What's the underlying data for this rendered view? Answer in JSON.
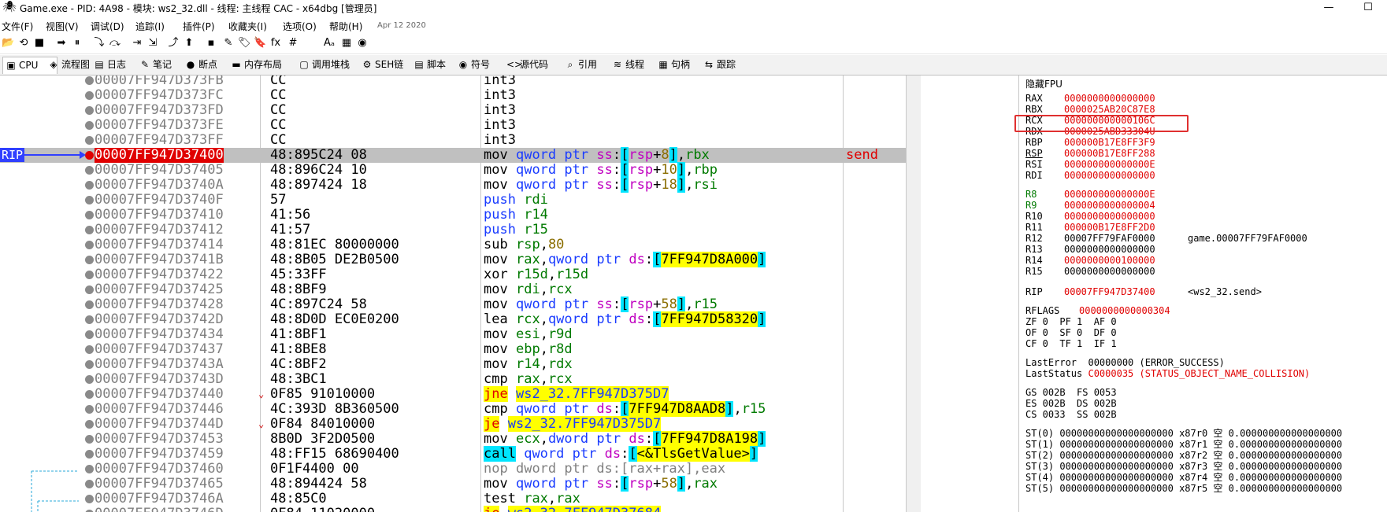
{
  "window": {
    "title": "Game.exe - PID: 4A98 - 模块: ws2_32.dll - 线程: 主线程 CAC - x64dbg [管理员]",
    "minimize": "—",
    "maximize": "☐"
  },
  "menu": {
    "items": [
      "文件(F)",
      "视图(V)",
      "调试(D)",
      "追踪(I)",
      "插件(P)",
      "收藏夹(I)",
      "选项(O)",
      "帮助(H)"
    ],
    "date": "Apr 12 2020"
  },
  "toolbar": {
    "icons": [
      "open-icon",
      "restart-icon",
      "stop-icon",
      "run-icon",
      "pause-icon",
      "step-into-icon",
      "step-over-icon",
      "trace-into-icon",
      "trace-over-icon",
      "execute-till-return-icon",
      "run-to-user-code-icon",
      "patch-icon",
      "comment-icon",
      "label-icon",
      "bookmark-icon",
      "function-icon",
      "tag-icon",
      "strings-icon",
      "calculator-icon",
      "script-icon"
    ],
    "glyphs": [
      "📂",
      "⟲",
      "■",
      "➡",
      "⏸",
      "⤵",
      "⤼",
      "⇥",
      "⇲",
      "⤴",
      "⬆",
      "▪",
      "✎",
      "🏷",
      "🔖",
      "fx",
      "#",
      "Aₐ",
      "▦",
      "◉"
    ]
  },
  "tabs": [
    {
      "label": "CPU",
      "icon": "cpu-icon",
      "glyph": "▣"
    },
    {
      "label": "流程图",
      "icon": "graph-icon",
      "glyph": "◈"
    },
    {
      "label": "日志",
      "icon": "log-icon",
      "glyph": "▤"
    },
    {
      "label": "笔记",
      "icon": "notes-icon",
      "glyph": "✎"
    },
    {
      "label": "断点",
      "icon": "breakpoint-icon",
      "glyph": "●"
    },
    {
      "label": "内存布局",
      "icon": "memory-map-icon",
      "glyph": "▬"
    },
    {
      "label": "调用堆栈",
      "icon": "call-stack-icon",
      "glyph": "▢"
    },
    {
      "label": "SEH链",
      "icon": "seh-icon",
      "glyph": "⚙"
    },
    {
      "label": "脚本",
      "icon": "script-icon",
      "glyph": "▤"
    },
    {
      "label": "符号",
      "icon": "symbols-icon",
      "glyph": "◉"
    },
    {
      "label": "源代码",
      "icon": "source-icon",
      "glyph": "<>"
    },
    {
      "label": "引用",
      "icon": "references-icon",
      "glyph": "⌕"
    },
    {
      "label": "线程",
      "icon": "threads-icon",
      "glyph": "≋"
    },
    {
      "label": "句柄",
      "icon": "handles-icon",
      "glyph": "▦"
    },
    {
      "label": "跟踪",
      "icon": "trace-icon",
      "glyph": "⇆"
    }
  ],
  "disasm": {
    "rip_label": "RIP",
    "rows": [
      {
        "addr": "00007FF947D373FB",
        "bytes": "CC",
        "instr": "int3"
      },
      {
        "addr": "00007FF947D373FC",
        "bytes": "CC",
        "instr": "int3"
      },
      {
        "addr": "00007FF947D373FD",
        "bytes": "CC",
        "instr": "int3"
      },
      {
        "addr": "00007FF947D373FE",
        "bytes": "CC",
        "instr": "int3"
      },
      {
        "addr": "00007FF947D373FF",
        "bytes": "CC",
        "instr": "int3"
      },
      {
        "addr": "00007FF947D37400",
        "bytes": "48:895C24 08",
        "instr": "mov qword ptr ss:[rsp+8],rbx",
        "comment": "send",
        "rip": true
      },
      {
        "addr": "00007FF947D37405",
        "bytes": "48:896C24 10",
        "instr": "mov qword ptr ss:[rsp+10],rbp"
      },
      {
        "addr": "00007FF947D3740A",
        "bytes": "48:897424 18",
        "instr": "mov qword ptr ss:[rsp+18],rsi"
      },
      {
        "addr": "00007FF947D3740F",
        "bytes": "57",
        "instr": "push rdi"
      },
      {
        "addr": "00007FF947D37410",
        "bytes": "41:56",
        "instr": "push r14"
      },
      {
        "addr": "00007FF947D37412",
        "bytes": "41:57",
        "instr": "push r15"
      },
      {
        "addr": "00007FF947D37414",
        "bytes": "48:81EC 80000000",
        "instr": "sub rsp,80"
      },
      {
        "addr": "00007FF947D3741B",
        "bytes": "48:8B05 DE2B0500",
        "instr": "mov rax,qword ptr ds:[7FF947D8A000]"
      },
      {
        "addr": "00007FF947D37422",
        "bytes": "45:33FF",
        "instr": "xor r15d,r15d"
      },
      {
        "addr": "00007FF947D37425",
        "bytes": "48:8BF9",
        "instr": "mov rdi,rcx"
      },
      {
        "addr": "00007FF947D37428",
        "bytes": "4C:897C24 58",
        "instr": "mov qword ptr ss:[rsp+58],r15"
      },
      {
        "addr": "00007FF947D3742D",
        "bytes": "48:8D0D EC0E0200",
        "instr": "lea rcx,qword ptr ds:[7FF947D58320]"
      },
      {
        "addr": "00007FF947D37434",
        "bytes": "41:8BF1",
        "instr": "mov esi,r9d"
      },
      {
        "addr": "00007FF947D37437",
        "bytes": "41:8BE8",
        "instr": "mov ebp,r8d"
      },
      {
        "addr": "00007FF947D3743A",
        "bytes": "4C:8BF2",
        "instr": "mov r14,rdx"
      },
      {
        "addr": "00007FF947D3743D",
        "bytes": "48:3BC1",
        "instr": "cmp rax,rcx"
      },
      {
        "addr": "00007FF947D37440",
        "bytes": "0F85 91010000",
        "instr": "jne ws2_32.7FF947D375D7",
        "jump": true
      },
      {
        "addr": "00007FF947D37446",
        "bytes": "4C:393D 8B360500",
        "instr": "cmp qword ptr ds:[7FF947D8AAD8],r15"
      },
      {
        "addr": "00007FF947D3744D",
        "bytes": "0F84 84010000",
        "instr": "je ws2_32.7FF947D375D7",
        "jump": true
      },
      {
        "addr": "00007FF947D37453",
        "bytes": "8B0D 3F2D0500",
        "instr": "mov ecx,dword ptr ds:[7FF947D8A198]"
      },
      {
        "addr": "00007FF947D37459",
        "bytes": "48:FF15 68690400",
        "instr": "call qword ptr ds:[<&TlsGetValue>]"
      },
      {
        "addr": "00007FF947D37460",
        "bytes": "0F1F4400 00",
        "instr": "nop dword ptr ds:[rax+rax],eax"
      },
      {
        "addr": "00007FF947D37465",
        "bytes": "48:894424 58",
        "instr": "mov qword ptr ss:[rsp+58],rax"
      },
      {
        "addr": "00007FF947D3746A",
        "bytes": "48:85C0",
        "instr": "test rax,rax"
      },
      {
        "addr": "00007FF947D3746D",
        "bytes": "0F84 11020000",
        "instr": "je ws2_32.7FF947D37684",
        "jump": true
      }
    ]
  },
  "registers": {
    "header": "隐藏FPU",
    "gp": [
      {
        "name": "RAX",
        "value": "0000000000000000"
      },
      {
        "name": "RBX",
        "value": "0000025AB20C87E8"
      },
      {
        "name": "RCX",
        "value": "000000000000106C"
      },
      {
        "name": "RDX",
        "value": "0000025ABD33304U"
      },
      {
        "name": "RBP",
        "value": "000000B17E8FF3F9"
      },
      {
        "name": "RSP",
        "value": "000000B17E8FF288"
      },
      {
        "name": "RSI",
        "value": "000000000000000E"
      },
      {
        "name": "RDI",
        "value": "0000000000000000"
      },
      {
        "name": "R8",
        "value": "000000000000000E",
        "green": true
      },
      {
        "name": "R9",
        "value": "0000000000000004",
        "green": true
      },
      {
        "name": "R10",
        "value": "0000000000000000"
      },
      {
        "name": "R11",
        "value": "000000B17E8FF2D0"
      },
      {
        "name": "R12",
        "value": "00007FF79FAF0000",
        "black": true,
        "comment": "game.00007FF79FAF0000"
      },
      {
        "name": "R13",
        "value": "0000000000000000",
        "black": true
      },
      {
        "name": "R14",
        "value": "0000000000100000"
      },
      {
        "name": "R15",
        "value": "0000000000000000",
        "black": true
      }
    ],
    "rip": {
      "name": "RIP",
      "value": "00007FF947D37400",
      "comment": "<ws2_32.send>"
    },
    "rflags": {
      "name": "RFLAGS",
      "value": "0000000000000304"
    },
    "flags": [
      "ZF 0  PF 1  AF 0",
      "OF 0  SF 0  DF 0",
      "CF 0  TF 1  IF 1"
    ],
    "last_error": "LastError  00000000 (ERROR_SUCCESS)",
    "last_status_label": "LastStatus",
    "last_status_value": "C0000035 (STATUS_OBJECT_NAME_COLLISION)",
    "segments": [
      "GS 002B  FS 0053",
      "ES 002B  DS 002B",
      "CS 0033  SS 002B"
    ],
    "fpu": [
      "ST(0) 00000000000000000000 x87r0 空 0.000000000000000000",
      "ST(1) 00000000000000000000 x87r1 空 0.000000000000000000",
      "ST(2) 00000000000000000000 x87r2 空 0.000000000000000000",
      "ST(3) 00000000000000000000 x87r3 空 0.000000000000000000",
      "ST(4) 00000000000000000000 x87r4 空 0.000000000000000000",
      "ST(5) 00000000000000000000 x87r5 空 0.000000000000000000"
    ]
  }
}
